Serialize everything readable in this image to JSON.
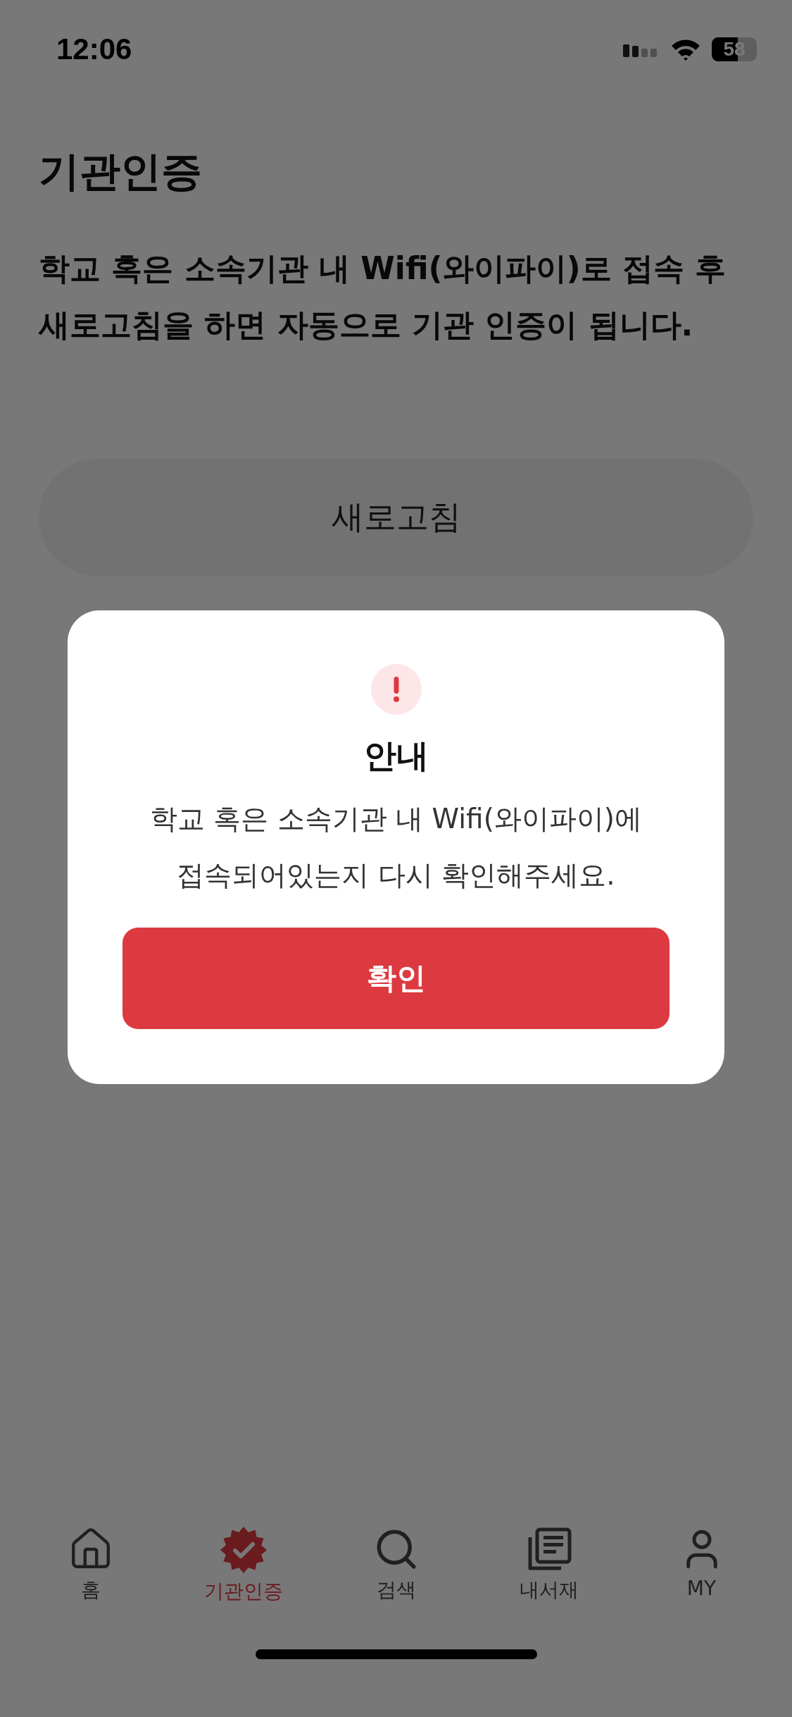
{
  "status_bar": {
    "time": "12:06",
    "battery": "58"
  },
  "page": {
    "title": "기관인증",
    "description": "학교 혹은 소속기관 내 Wifi(와이파이)로 접속 후 새로고침을 하면 자동으로 기관 인증이 됩니다.",
    "refresh_button": "새로고침"
  },
  "dialog": {
    "title": "안내",
    "message": "학교 혹은 소속기관 내 Wifi(와이파이)에\n접속되어있는지 다시 확인해주세요.",
    "confirm_button": "확인"
  },
  "tab_bar": [
    {
      "kind": "home",
      "label": "홈",
      "selected": false
    },
    {
      "kind": "badge",
      "label": "기관인증",
      "selected": true
    },
    {
      "kind": "search",
      "label": "검색",
      "selected": false
    },
    {
      "kind": "library",
      "label": "내서재",
      "selected": false
    },
    {
      "kind": "profile",
      "label": "MY",
      "selected": false
    }
  ]
}
